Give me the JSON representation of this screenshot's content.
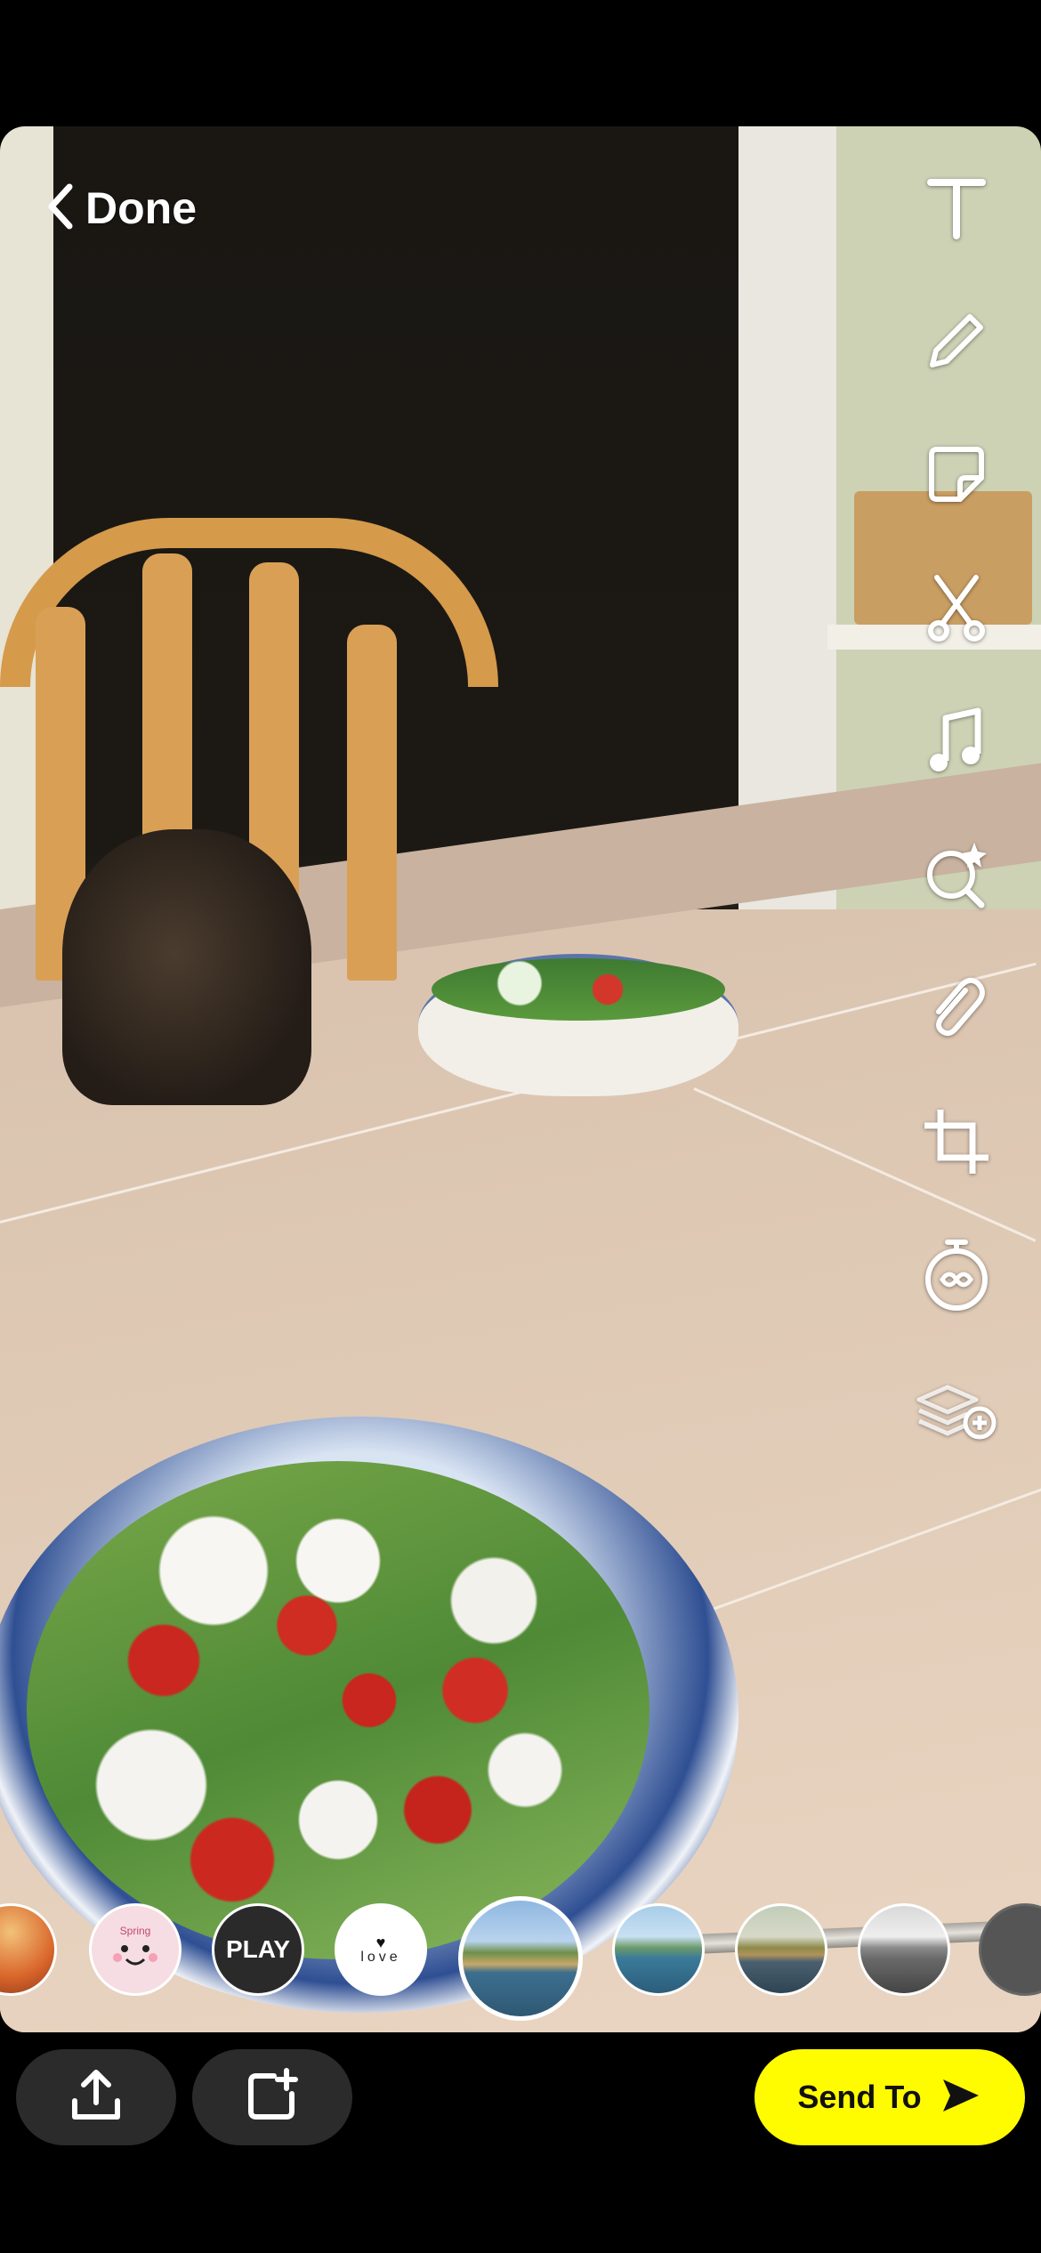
{
  "header": {
    "done_label": "Done",
    "back_icon": "chevron-left-icon"
  },
  "toolbar": {
    "tools": [
      {
        "name": "text-tool",
        "icon": "text-icon"
      },
      {
        "name": "draw-tool",
        "icon": "pencil-icon"
      },
      {
        "name": "sticker-tool",
        "icon": "sticker-icon"
      },
      {
        "name": "scissors-tool",
        "icon": "scissors-icon"
      },
      {
        "name": "music-tool",
        "icon": "music-note-icon"
      },
      {
        "name": "lens-search-tool",
        "icon": "lens-search-icon"
      },
      {
        "name": "attach-link-tool",
        "icon": "paperclip-icon"
      },
      {
        "name": "crop-tool",
        "icon": "crop-icon"
      },
      {
        "name": "timer-tool",
        "icon": "timer-icon"
      },
      {
        "name": "layers-tool",
        "icon": "layers-plus-icon"
      }
    ]
  },
  "lenses": {
    "items": [
      {
        "name": "lens-sunset",
        "label": ""
      },
      {
        "name": "lens-spring-face",
        "label": "Spring"
      },
      {
        "name": "lens-play",
        "label": "PLAY"
      },
      {
        "name": "lens-love",
        "label": "love"
      },
      {
        "name": "lens-landscape-color",
        "label": "",
        "selected": true
      },
      {
        "name": "lens-landscape-cool",
        "label": ""
      },
      {
        "name": "lens-landscape-warm",
        "label": ""
      },
      {
        "name": "lens-landscape-bw",
        "label": ""
      },
      {
        "name": "lens-more",
        "label": ""
      }
    ]
  },
  "bottom": {
    "share_icon": "share-upload-icon",
    "add_story_icon": "add-to-story-icon",
    "send_label": "Send To",
    "send_icon": "send-arrow-icon"
  },
  "colors": {
    "send_button": "#fffc00",
    "button_dark": "#2b2b2b"
  }
}
